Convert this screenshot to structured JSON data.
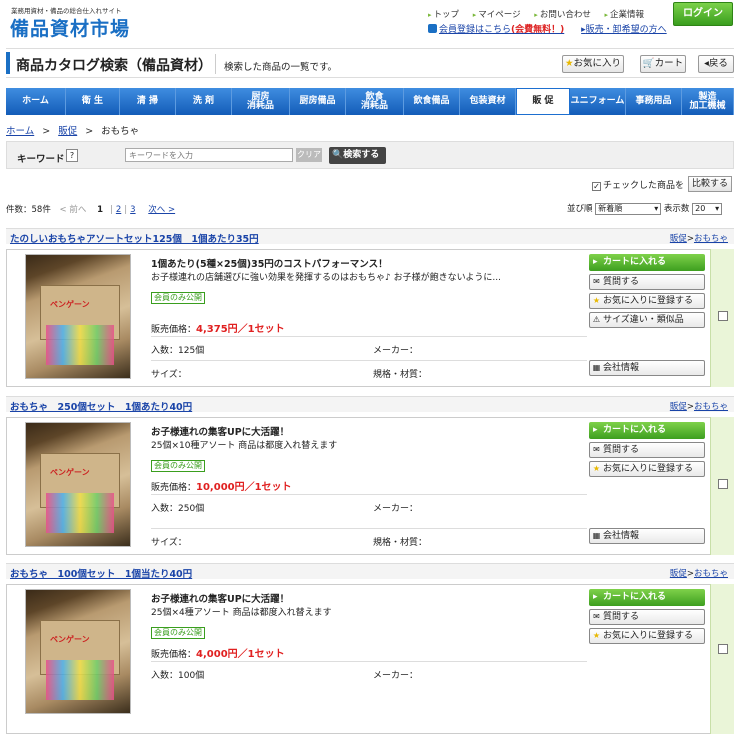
{
  "header": {
    "tagline": "業務用資材・備品の総合仕入れサイト",
    "logo": "備品資材市場",
    "links": [
      "トップ",
      "マイページ",
      "お問い合わせ",
      "企業情報"
    ],
    "register_prefix": "会員登録はこちら",
    "register_free": "(会費無料！)",
    "agent_link": "販売・卸希望の方へ",
    "login_label": "ログイン"
  },
  "titlebar": {
    "title": "商品カタログ検索（備品資材）",
    "description": "検索した商品の一覧です。",
    "favorites_label": "お気に入り",
    "cart_label": "カート",
    "back_label": "戻る"
  },
  "nav": [
    {
      "label": "ホーム",
      "w": 60
    },
    {
      "label": "衛 生",
      "w": 54
    },
    {
      "label": "清 掃",
      "w": 56
    },
    {
      "label": "洗 剤",
      "w": 56
    },
    {
      "label": "厨房\n消耗品",
      "w": 58
    },
    {
      "label": "厨房備品",
      "w": 56
    },
    {
      "label": "飲食\n消耗品",
      "w": 58
    },
    {
      "label": "飲食備品",
      "w": 56
    },
    {
      "label": "包装資材",
      "w": 56
    },
    {
      "label": "販 促",
      "w": 54,
      "active": true
    },
    {
      "label": "ユニフォーム",
      "w": 56
    },
    {
      "label": "事務用品",
      "w": 56
    },
    {
      "label": "製造\n加工機械",
      "w": 52
    }
  ],
  "breadcrumb": {
    "home": "ホーム",
    "category": "販促",
    "current": "おもちゃ"
  },
  "search": {
    "label": "キーワード",
    "help": "?",
    "placeholder": "キーワードを入力",
    "clear": "クリア",
    "button": "検索する"
  },
  "compare": {
    "checked_label": "チェックした商品を",
    "button": "比較する"
  },
  "pager": {
    "count": "件数：58件",
    "prev": "< 前へ",
    "pages": [
      "1",
      "2",
      "3"
    ],
    "next": "次へ >",
    "sort_label": "並び順",
    "sort_value": "新着順",
    "per_page_label": "表示数",
    "per_page_value": "20"
  },
  "product_labels": {
    "member_only": "会員のみ公開",
    "price_label": "販売価格：",
    "qty_label": "入数：",
    "maker_label": "メーカー：",
    "size_label": "サイズ：",
    "spec_label": "規格・材質：",
    "add_cart": "カートに入れる",
    "question": "質問する",
    "add_fav": "お気に入りに登録する",
    "similar": "サイズ違い・類似品",
    "company": "会社情報",
    "cat_parent": "販促",
    "cat_child": "おもちゃ"
  },
  "products": [
    {
      "name": "たのしいおもちゃアソートセット125個　1個あたり35円",
      "headline": "1個あたり(5種×25個)35円のコストパフォーマンス！",
      "desc": "お子様連れの店舗選びに強い効果を発揮するのはおもちゃ♪ お子様が飽きないように...",
      "price": "4,375円／1セット",
      "qty": "125個",
      "image_label": "ペンゲーン"
    },
    {
      "name": "おもちゃ　250個セット　1個あたり40円",
      "headline": "お子様連れの集客UPに大活躍！",
      "desc": "25個×10種アソート 商品は都度入れ替えます",
      "price": "10,000円／1セット",
      "qty": "250個",
      "image_label": "ペンゲーン"
    },
    {
      "name": "おもちゃ　100個セット　1個当たり40円",
      "headline": "お子様連れの集客UPに大活躍！",
      "desc": "25個×4種アソート 商品は都度入れ替えます",
      "price": "4,000円／1セット",
      "qty": "100個",
      "image_label": "ペンゲーン"
    }
  ]
}
